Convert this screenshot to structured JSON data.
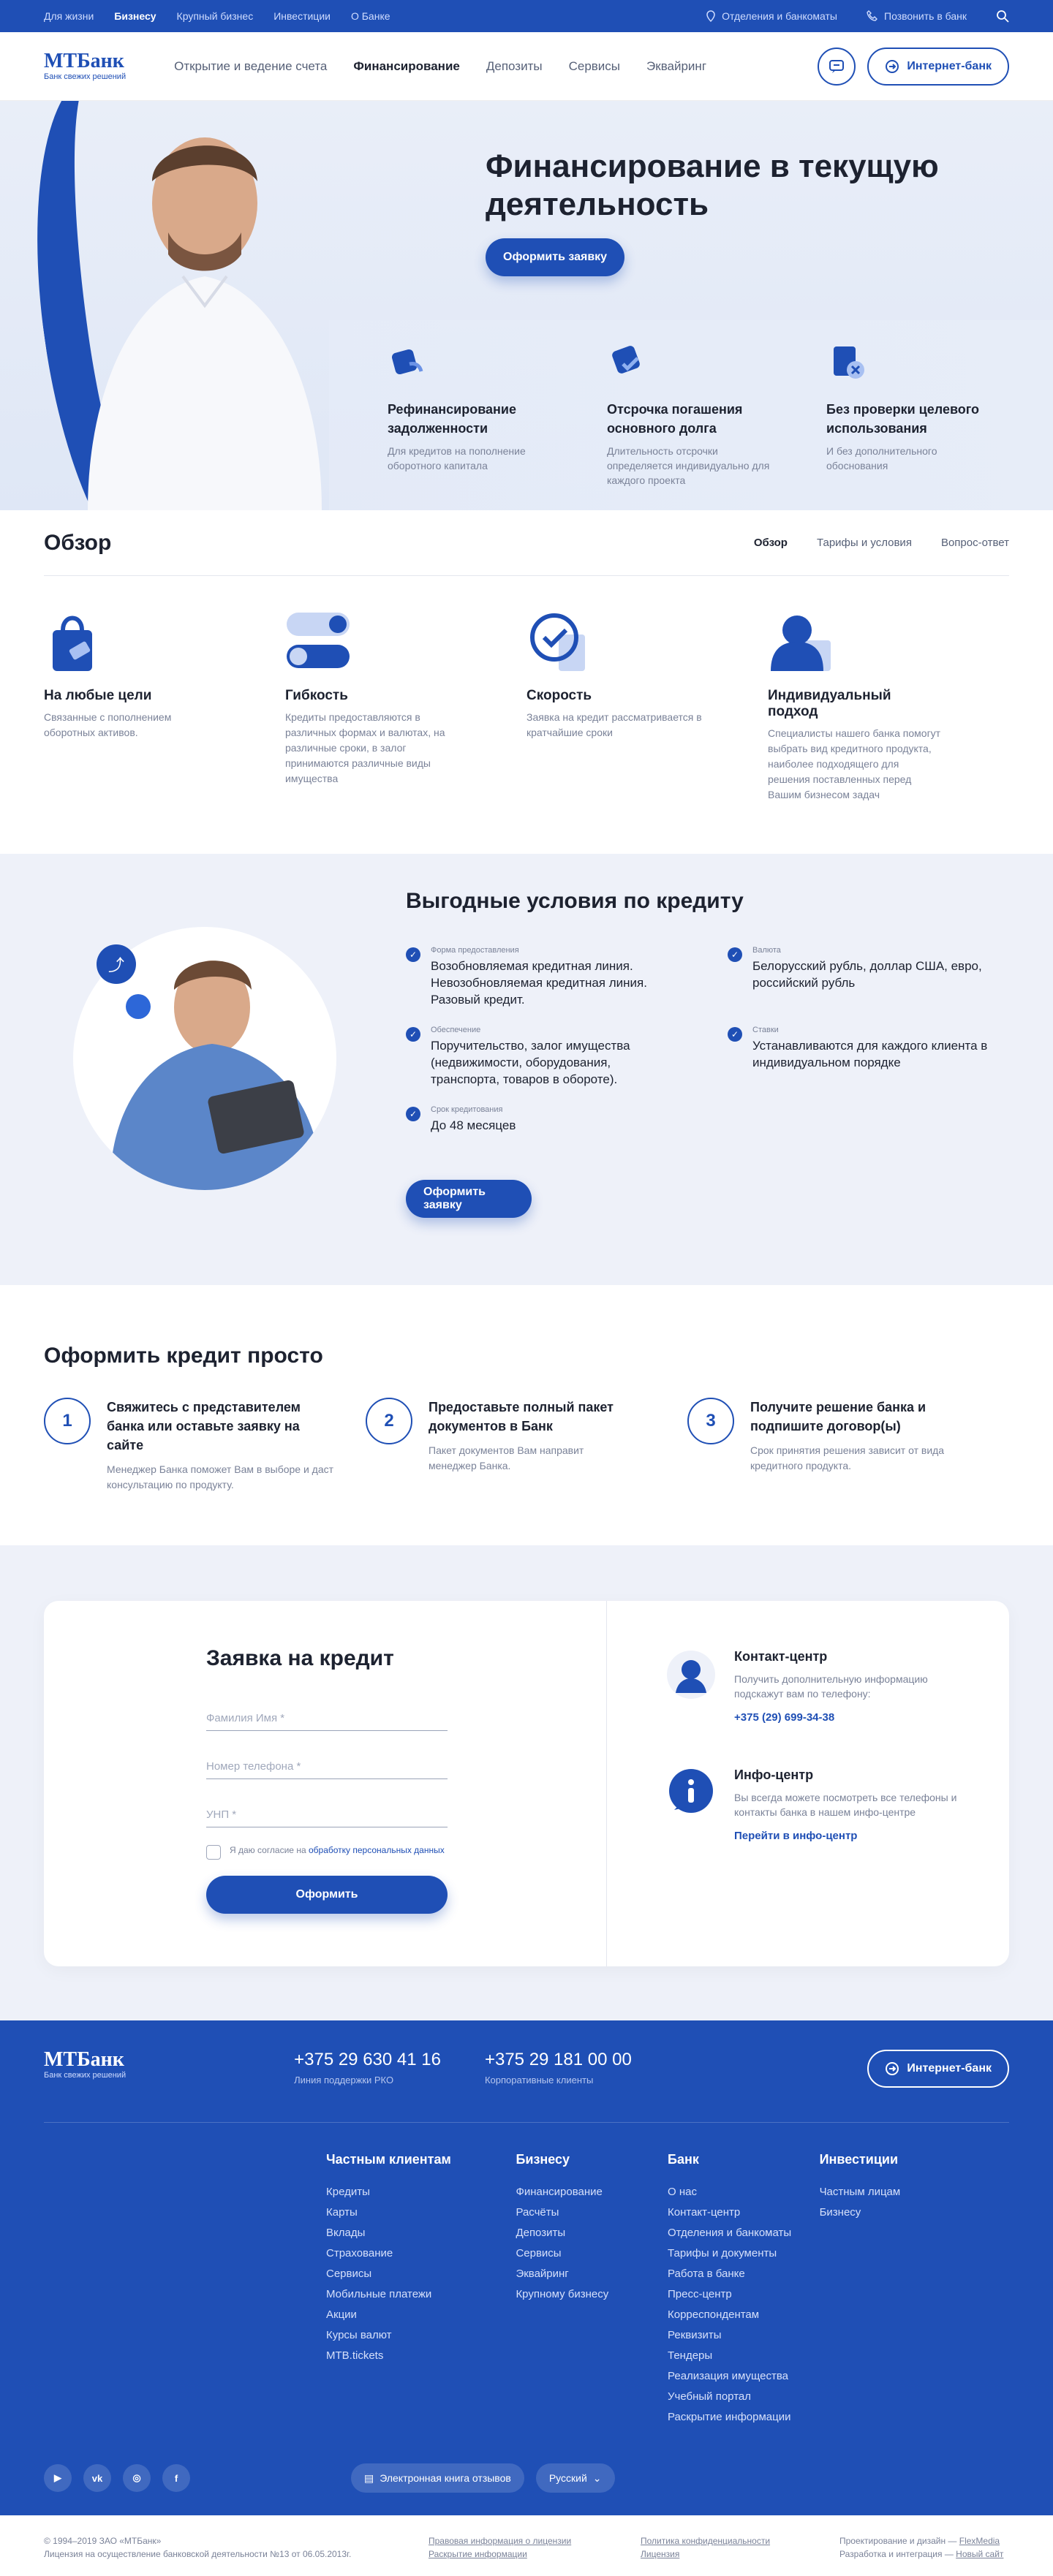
{
  "topbar": {
    "links": [
      "Для жизни",
      "Бизнесу",
      "Крупный бизнес",
      "Инвестиции",
      "О Банке"
    ],
    "branches": "Отделения и банкоматы",
    "call": "Позвонить в банк"
  },
  "logo": {
    "name": "МТБанк",
    "slogan": "Банк свежих решений"
  },
  "nav": [
    "Открытие и ведение счета",
    "Финансирование",
    "Депозиты",
    "Сервисы",
    "Эквайринг"
  ],
  "internet_bank": "Интернет-банк",
  "hero": {
    "title": "Финансирование в текущую деятельность",
    "button": "Оформить заявку",
    "features": [
      {
        "title": "Рефинансирование задолженности",
        "desc": "Для кредитов на пополнение оборотного капитала"
      },
      {
        "title": "Отсрочка погашения основного долга",
        "desc": "Длительность отсрочки определяется индивидуально для каждого проекта"
      },
      {
        "title": "Без проверки целевого использования",
        "desc": "И без дополнительного обоснования"
      }
    ]
  },
  "overview": {
    "title": "Обзор",
    "tabs": [
      "Обзор",
      "Тарифы и условия",
      "Вопрос-ответ"
    ],
    "items": [
      {
        "title": "На любые цели",
        "desc": "Связанные с пополнением оборотных активов."
      },
      {
        "title": "Гибкость",
        "desc": "Кредиты предоставляются в различных формах и валютах, на различные сроки, в залог принимаются различные виды имущества"
      },
      {
        "title": "Скорость",
        "desc": "Заявка на кредит рассматривается в кратчайшие сроки"
      },
      {
        "title": "Индивидуальный подход",
        "desc": "Специалисты нашего банка помогут выбрать вид кредитного продукта, наиболее подходящего для решения поставленных перед Вашим бизнесом задач"
      }
    ]
  },
  "conditions": {
    "title": "Выгодные условия по кредиту",
    "button": "Оформить заявку",
    "items": [
      {
        "label": "Форма предоставления",
        "value": "Возобновляемая кредитная линия. Невозобновляемая кредитная линия. Разовый кредит."
      },
      {
        "label": "Валюта",
        "value": "Белорусский рубль, доллар США, евро, российский рубль"
      },
      {
        "label": "Обеспечение",
        "value": "Поручительство, залог имущества (недвижимости, оборудования, транспорта, товаров в обороте)."
      },
      {
        "label": "Ставки",
        "value": "Устанавливаются для каждого клиента в индивидуальном порядке"
      },
      {
        "label": "Срок кредитования",
        "value": "До 48 месяцев"
      }
    ]
  },
  "steps": {
    "title": "Оформить кредит просто",
    "items": [
      {
        "num": "1",
        "title": "Свяжитесь с представителем банка или оставьте заявку на сайте",
        "desc": "Менеджер Банка поможет Вам в выборе и даст консультацию по продукту."
      },
      {
        "num": "2",
        "title": "Предоставьте полный пакет документов в Банк",
        "desc": "Пакет документов Вам направит менеджер Банка."
      },
      {
        "num": "3",
        "title": "Получите решение банка и подпишите договор(ы)",
        "desc": "Срок принятия решения зависит от вида кредитного продукта."
      }
    ]
  },
  "application": {
    "title": "Заявка на кредит",
    "name_ph": "Фамилия Имя *",
    "phone_ph": "Номер телефона *",
    "unp_ph": "УНП *",
    "agree_text": "Я даю согласие на",
    "agree_link": "обработку персональных данных",
    "button": "Оформить",
    "contact": {
      "title": "Контакт-центр",
      "desc": "Получить дополнительную информацию подскажут вам по телефону:",
      "link": "+375 (29) 699-34-38"
    },
    "info": {
      "title": "Инфо-центр",
      "desc": "Вы всегда можете посмотреть все телефоны и контакты банка в нашем инфо-центре",
      "link": "Перейти в инфо-центр"
    }
  },
  "footer": {
    "phone1": "+375 29 630 41 16",
    "phone1_label": "Линия поддержки РКО",
    "phone2": "+375 29 181 00 00",
    "phone2_label": "Корпоративные клиенты",
    "cols": [
      {
        "title": "Частным клиентам",
        "items": [
          "Кредиты",
          "Карты",
          "Вклады",
          "Страхование",
          "Сервисы",
          "Мобильные платежи",
          "Акции",
          "Курсы валют",
          "MTB.tickets"
        ]
      },
      {
        "title": "Бизнесу",
        "items": [
          "Финансирование",
          "Расчёты",
          "Депозиты",
          "Сервисы",
          "Эквайринг",
          "Крупному бизнесу"
        ]
      },
      {
        "title": "Банк",
        "items": [
          "О нас",
          "Контакт-центр",
          "Отделения и банкоматы",
          "Тарифы и документы",
          "Работа в банке",
          "Пресс-центр",
          "Корреспондентам",
          "Реквизиты",
          "Тендеры",
          "Реализация имущества",
          "Учебный портал",
          "Раскрытие информации"
        ]
      },
      {
        "title": "Инвестиции",
        "items": [
          "Частным лицам",
          "Бизнесу"
        ]
      }
    ],
    "social": [
      "▶",
      "vk",
      "◎",
      "f"
    ],
    "reviews": "Электронная книга отзывов",
    "lang": "Русский"
  },
  "legal": {
    "copy": "© 1994–2019 ЗАО «МТБанк»",
    "license": "Лицензия на осуществление банковской деятельности №13 от 06.05.2013г.",
    "l1": "Правовая информация о лицензии",
    "l2": "Раскрытие информации",
    "l3": "Политика конфиденциальности",
    "l4": "Лицензия",
    "d1": "Проектирование и дизайн — ",
    "d1l": "FlexMedia",
    "d2": "Разработка и интеграция — ",
    "d2l": "Новый сайт"
  }
}
